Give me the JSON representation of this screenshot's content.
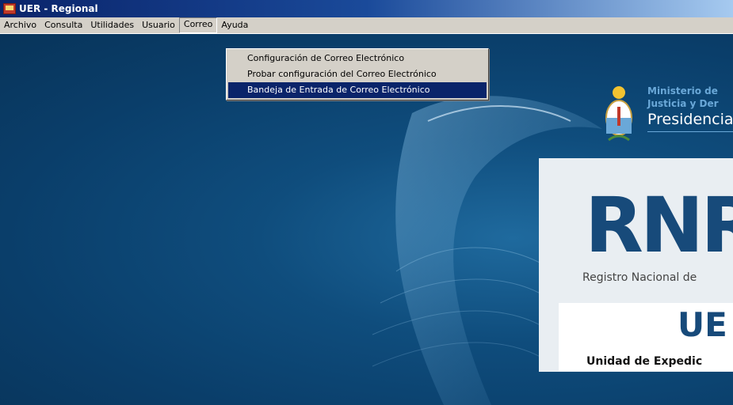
{
  "window": {
    "title": "UER - Regional"
  },
  "menubar": {
    "items": [
      {
        "label": "Archivo"
      },
      {
        "label": "Consulta"
      },
      {
        "label": "Utilidades"
      },
      {
        "label": "Usuario"
      },
      {
        "label": "Correo"
      },
      {
        "label": "Ayuda"
      }
    ]
  },
  "correo_menu": {
    "items": [
      {
        "label": "Configuración de Correo Electrónico"
      },
      {
        "label": "Probar configuración del Correo Electrónico"
      },
      {
        "label": "Bandeja de Entrada de Correo Electrónico"
      }
    ],
    "selected_index": 2
  },
  "background": {
    "ministry_line1": "Ministerio de",
    "ministry_line2": "Justicia y Der",
    "ministry_line3": "Presidencia",
    "rnp_logo": "RNR",
    "rnp_subtitle": "Registro Nacional de",
    "uer_logo": "UE",
    "uer_subtitle": "Unidad de Expedic"
  },
  "colors": {
    "desktop": "#0a3e6a",
    "menu_highlight": "#0a246a",
    "logo_blue": "#174a7a"
  }
}
